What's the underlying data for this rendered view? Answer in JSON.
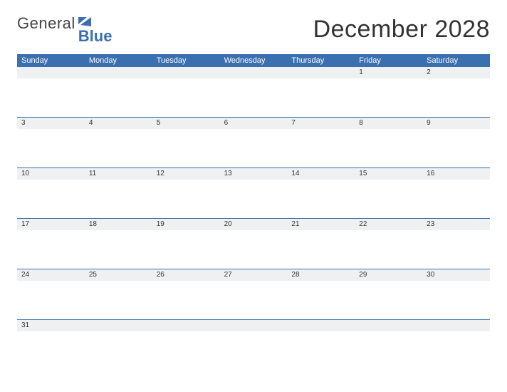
{
  "brand": {
    "word1": "General",
    "word2": "Blue"
  },
  "title": "December 2028",
  "weekdays": [
    "Sunday",
    "Monday",
    "Tuesday",
    "Wednesday",
    "Thursday",
    "Friday",
    "Saturday"
  ],
  "weeks": [
    [
      "",
      "",
      "",
      "",
      "",
      "1",
      "2"
    ],
    [
      "3",
      "4",
      "5",
      "6",
      "7",
      "8",
      "9"
    ],
    [
      "10",
      "11",
      "12",
      "13",
      "14",
      "15",
      "16"
    ],
    [
      "17",
      "18",
      "19",
      "20",
      "21",
      "22",
      "23"
    ],
    [
      "24",
      "25",
      "26",
      "27",
      "28",
      "29",
      "30"
    ],
    [
      "31",
      "",
      "",
      "",
      "",
      "",
      ""
    ]
  ]
}
